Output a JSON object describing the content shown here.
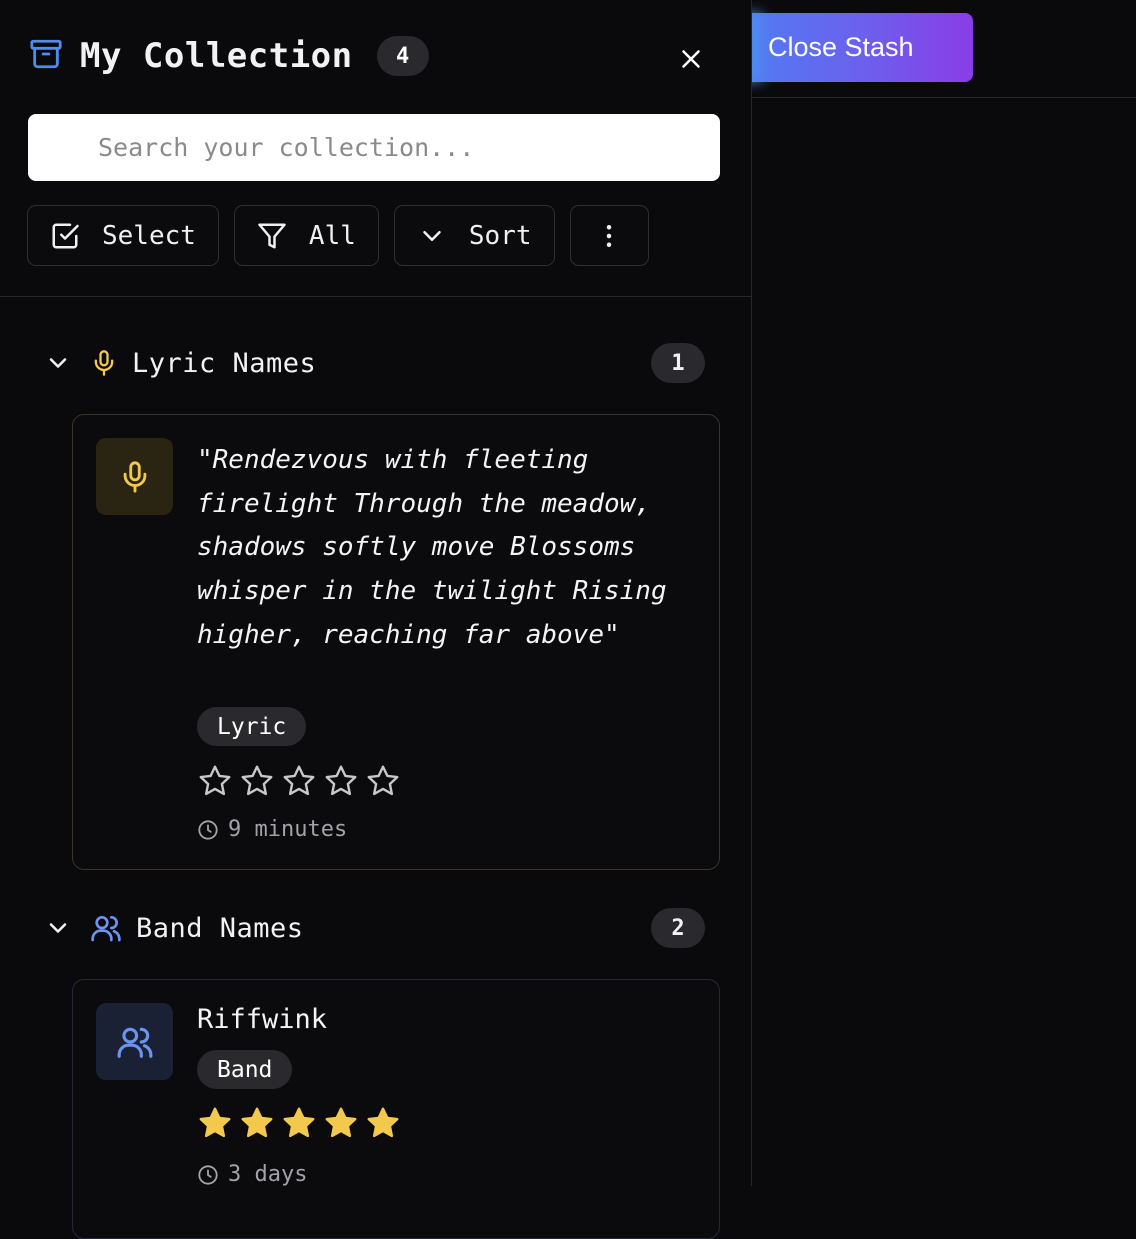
{
  "stash_button": {
    "label": "Close Stash"
  },
  "header": {
    "title": "My Collection",
    "count": "4"
  },
  "search": {
    "placeholder": "Search your collection..."
  },
  "toolbar": {
    "select_label": "Select",
    "filter_label": "All",
    "sort_label": "Sort"
  },
  "groups": [
    {
      "title": "Lyric Names",
      "count": "1",
      "icon": "microphone-icon",
      "accent": "#f2c94c",
      "items": [
        {
          "text": "\"Rendezvous with fleeting firelight Through the meadow, shadows softly move Blossoms whisper in the twilight Rising higher, reaching far above\"",
          "tag": "Lyric",
          "rating": 0,
          "time": "9 minutes"
        }
      ]
    },
    {
      "title": "Band Names",
      "count": "2",
      "icon": "users-icon",
      "accent": "#6b93f0",
      "items": [
        {
          "name": "Riffwink",
          "tag": "Band",
          "rating": 5,
          "time": "3 days"
        }
      ]
    }
  ],
  "colors": {
    "star_filled": "#f2c94c",
    "star_empty": "#c8c8cc"
  }
}
